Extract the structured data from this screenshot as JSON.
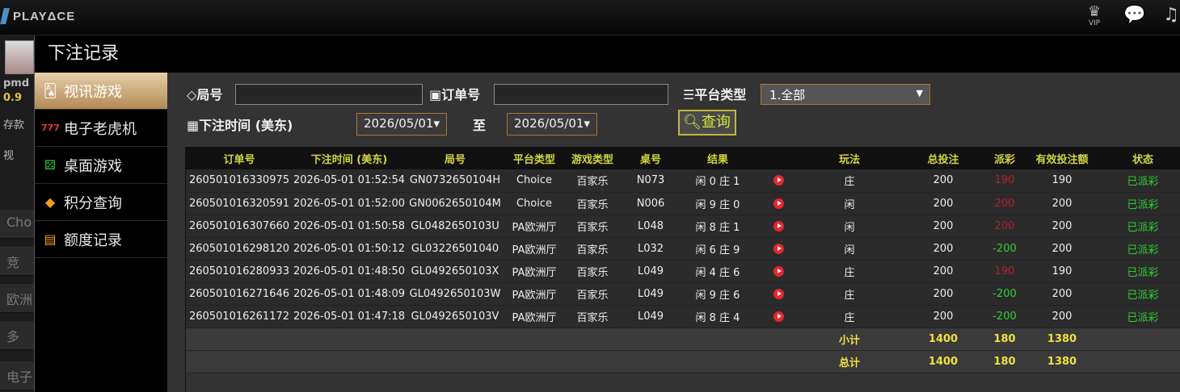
{
  "app": {
    "logo": "PLAYΔCE"
  },
  "topbar": {
    "vip_label": "VIP"
  },
  "underlying": {
    "user": "pmd",
    "balance": "0.9",
    "deposit": "存款",
    "video": "视",
    "tab1": "Cho",
    "tab2": "竞",
    "tab3": "欧洲",
    "tab4": "多",
    "tab5": "电子"
  },
  "modal": {
    "title": "下注记录",
    "menu": [
      {
        "label": "视讯游戏",
        "icon": "playing-cards-icon"
      },
      {
        "label": "电子老虎机",
        "icon": "slot-777-icon"
      },
      {
        "label": "桌面游戏",
        "icon": "dice-icon"
      },
      {
        "label": "积分查询",
        "icon": "diamond-icon"
      },
      {
        "label": "额度记录",
        "icon": "document-icon"
      }
    ]
  },
  "filters": {
    "round_label": "局号",
    "round_value": "",
    "order_label": "订单号",
    "order_value": "",
    "platform_label": "平台类型",
    "platform_selected": "1.全部",
    "time_label": "下注时间 (美东)",
    "date_from": "2026/05/01▾",
    "to_label": "至",
    "date_to": "2026/05/01▾",
    "query_label": "查询"
  },
  "table": {
    "headers": [
      "订单号",
      "下注时间 (美东)",
      "局号",
      "平台类型",
      "游戏类型",
      "桌号",
      "结果",
      "",
      "玩法",
      "总投注",
      "派彩",
      "有效投注额",
      "状态"
    ],
    "rows": [
      [
        "260501016330975",
        "2026-05-01 01:52:54",
        "GN0732650104H",
        "Choice",
        "百家乐",
        "N073",
        "闲 0 庄 1",
        "",
        "庄",
        "200",
        "190",
        "190",
        "已派彩"
      ],
      [
        "260501016320591",
        "2026-05-01 01:52:00",
        "GN0062650104M",
        "Choice",
        "百家乐",
        "N006",
        "闲 9 庄 0",
        "",
        "闲",
        "200",
        "200",
        "200",
        "已派彩"
      ],
      [
        "260501016307660",
        "2026-05-01 01:50:58",
        "GL0482650103U",
        "PA欧洲厅",
        "百家乐",
        "L048",
        "闲 8 庄 1",
        "",
        "闲",
        "200",
        "200",
        "200",
        "已派彩"
      ],
      [
        "260501016298120",
        "2026-05-01 01:50:12",
        "GL03226501040",
        "PA欧洲厅",
        "百家乐",
        "L032",
        "闲 6 庄 9",
        "",
        "闲",
        "200",
        "-200",
        "200",
        "已派彩"
      ],
      [
        "260501016280933",
        "2026-05-01 01:48:50",
        "GL0492650103X",
        "PA欧洲厅",
        "百家乐",
        "L049",
        "闲 4 庄 6",
        "",
        "庄",
        "200",
        "190",
        "190",
        "已派彩"
      ],
      [
        "260501016271646",
        "2026-05-01 01:48:09",
        "GL0492650103W",
        "PA欧洲厅",
        "百家乐",
        "L049",
        "闲 9 庄 6",
        "",
        "庄",
        "200",
        "-200",
        "200",
        "已派彩"
      ],
      [
        "260501016261172",
        "2026-05-01 01:47:18",
        "GL0492650103V",
        "PA欧洲厅",
        "百家乐",
        "L049",
        "闲 8 庄 4",
        "",
        "庄",
        "200",
        "-200",
        "200",
        "已派彩"
      ]
    ],
    "subtotal": {
      "label": "小计",
      "total_bet": "1400",
      "payout": "180",
      "valid_bet": "1380"
    },
    "grandtotal": {
      "label": "总计",
      "total_bet": "1400",
      "payout": "180",
      "valid_bet": "1380"
    }
  },
  "colors": {
    "accent": "#c2b73a",
    "header_text": "#d4d442",
    "positive": "#2fcf2f",
    "negative": "#b2222e",
    "menu_active": "#c7a06a"
  }
}
